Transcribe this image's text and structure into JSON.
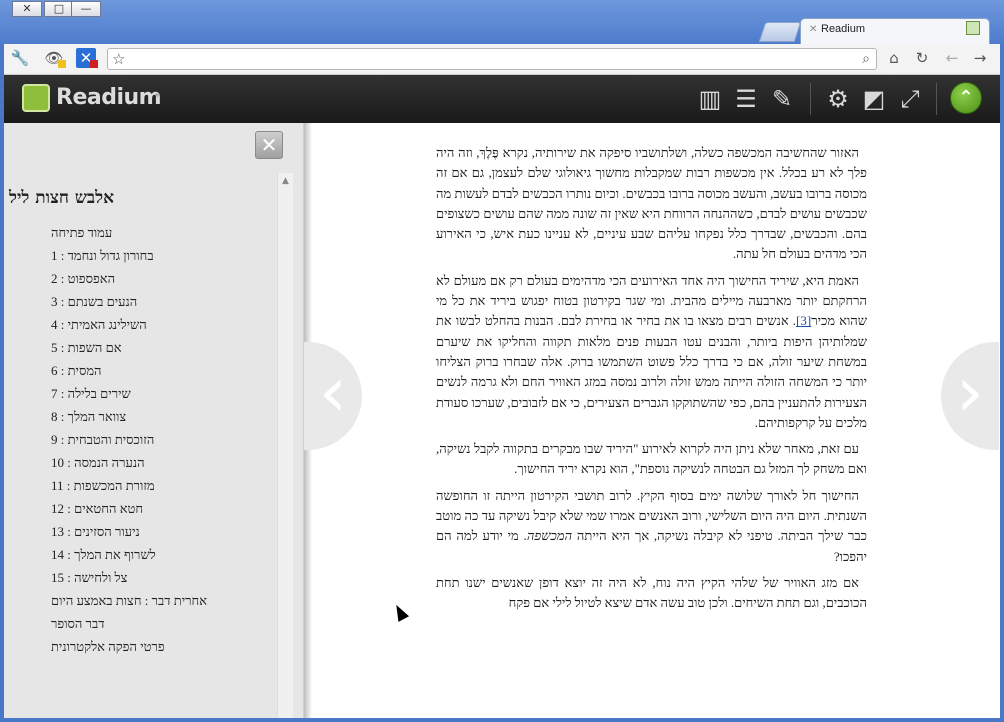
{
  "window": {
    "close_glyph": "✕",
    "maximize_glyph": "□",
    "minimize_glyph": "—",
    "tab_title": "Readium",
    "tab_close_glyph": "✕"
  },
  "toolbar": {
    "wrench_icon": "wrench-icon",
    "omnibox_value": "",
    "star_glyph": "☆",
    "search_glyph": "🔍",
    "home_glyph": "⌂",
    "reload_glyph": "↻",
    "back_glyph": "←",
    "forward_glyph": "→"
  },
  "readium": {
    "logo_text": "Readium",
    "logo_caret": "▾",
    "library_glyph": "▥",
    "toc_glyph": "☰",
    "notes_glyph": "✎",
    "settings_glyph": "⚙",
    "contrast_glyph": "◩",
    "fullscreen_glyph": "⤢",
    "up_glyph": "⌃",
    "accent_green": "#5aa01f"
  },
  "toc": {
    "close_glyph": "✕",
    "title": "אלבש חצות ליל",
    "items": [
      "עמוד פתיחה",
      "בחורון גדול ונחמד : 1",
      "האפספוט : 2",
      "הנעים בשנתם : 3",
      "השילינג האמיתי : 4",
      "אם השפות : 5",
      "המסית : 6",
      "שירים בלילה : 7",
      "צוואר המלך : 8",
      "הזוכסית והטבחית : 9",
      "הנערה הנמסה : 10",
      "מזורת המכשפות : 11",
      "חטא החטאים : 12",
      "ניעור הסזינים : 13",
      "לשרוף את המלך : 14",
      "צל ולחישה : 15",
      "אחרית דבר : חצות באמצע היום",
      "דבר הסופר",
      "פרטי הפקה אלקטרונית"
    ]
  },
  "nav": {
    "prev_glyph": "‹",
    "next_glyph": "›"
  },
  "page": {
    "p1": "האזור שהחשיבה המכשפה כשלה, ושלתושביו סיפקה את שירותיה, נקרא פֶּלֶךְ, וזה היה פלך לא רע בכלל. אין מכשפות רבות שמקבלות מחשוך גיאולוגי שלם לעצמן, גם אם זה מכוסה ברובו בעשב, והעשב מכוסה ברובו בכבשים. וכיום נותרו הכבשים לבדם לעשות מה שכבשים עושים לבדם, כשההנחה הרווחת היא שאין זה שונה ממה שהם עושים כשצופים בהם. והכבשים, שבדרך כלל נפקחו עליהם שבע עיניים, לא עניינו כעת איש, כי האירוע הכי מדהים בעולם חל עתה.",
    "p2_a": "האמת היא, שיריד החישוך היה אחד האירועים הכי מדהימים בעולם רק אם מעולם לא הרחקתם יותר מארבעה מיילים מהבית. ומי שגר בקירטון בטוח יפגוש ביריד את כל מי שהוא מכיר",
    "p2_ref": "[3]",
    "p2_b": ". אנשים רבים מצאו בו את בחיר או בחירת לבם. הבנות בהחלט לבשו את שמלותיהן היפות ביותר, והבנים עטו הבעות פנים מלאות תקווה והחליקו את שיערם במשחת שיער זולה, אם כי בדרך כלל פשוט השתמשו ברוק. אלה שבחרו ברוק הצליחו יותר כי המשחה הזולה הייתה ממש זולה ולרוב נמסה במזג האוויר החם ולא גרמה לנשים הצעירות להתעניין בהם, כפי שהשתוקקו הגברים הצעירים, כי אם לזבובים, שערכו סעודת מלכים על קרקפותיהם.",
    "p3": "עם זאת, מאחר שלא ניתן היה לקרוא לאירוע \"היריד שבו מבקרים בתקווה לקבל נשיקה, ואם משחק לך המזל גם הבטחה לנשיקה נוספת\", הוא נקרא יריד החישוך.",
    "p4_a": "החישוך חל לאורך שלושה ימים בסוף הקיץ. לרוב תושבי הקירטון הייתה זו החופשה השנתית. היום היה היום השלישי, ורוב האנשים אמרו שמי שלא קיבל נשיקה עד כה מוטב כבר שילך הביתה. טיפני לא קיבלה נשיקה, אך היא הייתה ",
    "p4_em": "המכשפה",
    "p4_b": ". מי יודע למה הם יהפכו?",
    "p5": "אם מזג האוויר של שלהי הקיץ היה נוח, לא היה זה יוצא דופן שאנשים ישנו תחת הכוכבים, וגם תחת השיחים. ולכן טוב עשה אדם שיצא לטיול לילי אם פקח"
  }
}
